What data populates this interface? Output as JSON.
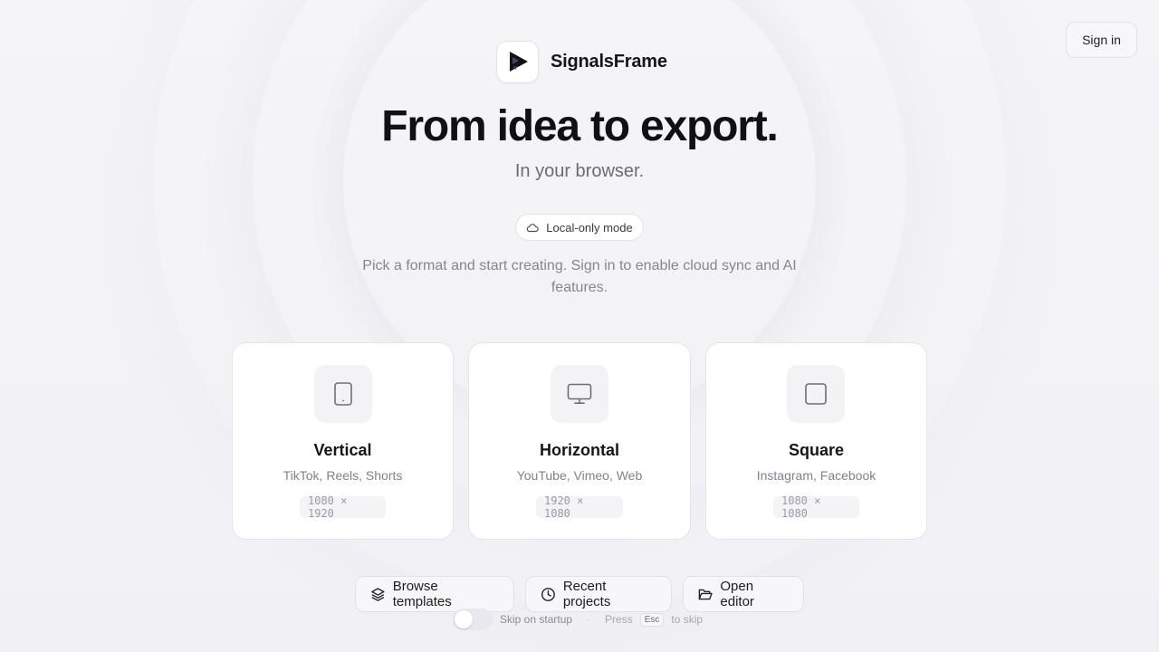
{
  "header": {
    "sign_in_label": "Sign in"
  },
  "brand": {
    "name": "SignalsFrame"
  },
  "hero": {
    "title": "From idea to export.",
    "subtitle": "In your browser."
  },
  "mode_badge": {
    "label": "Local-only mode",
    "icon": "cloud-icon"
  },
  "description": "Pick a format and start creating. Sign in to enable cloud sync and AI features.",
  "formats": [
    {
      "title": "Vertical",
      "platforms": "TikTok, Reels, Shorts",
      "dimensions": "1080 × 1920",
      "icon": "tablet-icon"
    },
    {
      "title": "Horizontal",
      "platforms": "YouTube, Vimeo, Web",
      "dimensions": "1920 × 1080",
      "icon": "monitor-icon"
    },
    {
      "title": "Square",
      "platforms": "Instagram, Facebook",
      "dimensions": "1080 × 1080",
      "icon": "square-icon"
    }
  ],
  "actions": {
    "browse_templates": "Browse templates",
    "recent_projects": "Recent projects",
    "open_editor": "Open editor"
  },
  "footer": {
    "skip_label": "Skip on startup",
    "skip_enabled": false,
    "press_label": "Press",
    "key_label": "Esc",
    "to_skip_label": "to skip"
  },
  "colors": {
    "background": "#f3f3f6",
    "card": "#ffffff",
    "text": "#111114",
    "muted": "#858592"
  }
}
